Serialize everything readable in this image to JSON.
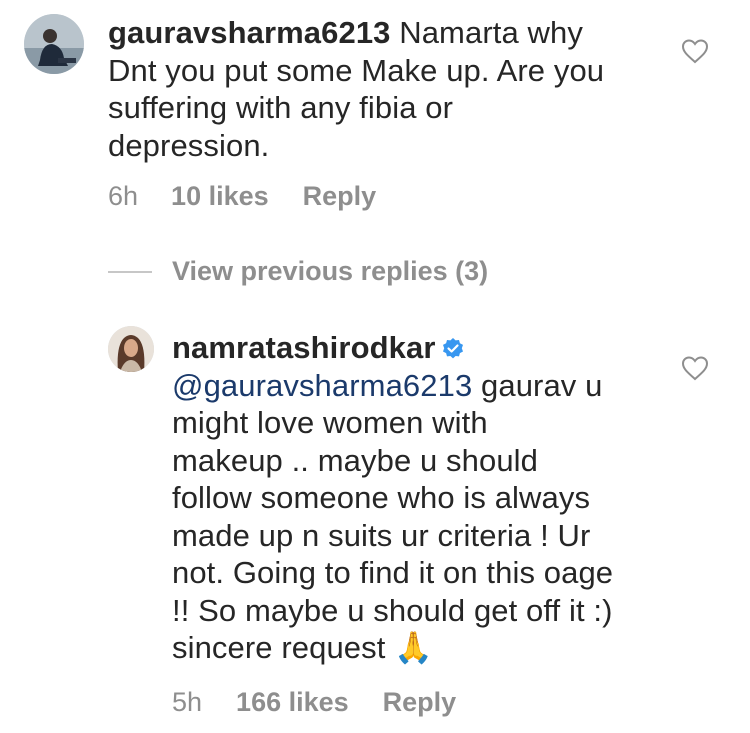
{
  "comment": {
    "username": "gauravsharma6213",
    "text_line1": "Namarta why",
    "text_line2": "Dnt you put some Make up. Are you",
    "text_line3": "suffering with any fibia or",
    "text_line4": "depression.",
    "time": "6h",
    "likes": "10 likes",
    "reply_label": "Reply",
    "avatar_icon": "user-avatar-man-sitting",
    "like_icon": "heart-outline-icon"
  },
  "view_previous": {
    "label": "View previous replies (3)"
  },
  "reply": {
    "username": "namratashirodkar",
    "verified_icon": "verified-badge-icon",
    "mention": "@gauravsharma6213",
    "line1_rest": " gaurav u",
    "line2": "might love women with",
    "line3": "makeup .. maybe u should",
    "line4": "follow someone  who is always",
    "line5": "made up n suits ur criteria !  Ur",
    "line6": "not. Going to find it on this oage",
    "line7": "!! So maybe u should get off it :)",
    "line8": "sincere request",
    "emoji": "🙏",
    "time": "5h",
    "likes": "166 likes",
    "reply_label": "Reply",
    "avatar_icon": "user-avatar-woman",
    "like_icon": "heart-outline-icon"
  },
  "colors": {
    "text": "#262626",
    "secondary": "#8e8e8e",
    "mention": "#1b3a6b",
    "verified": "#3897f0"
  }
}
